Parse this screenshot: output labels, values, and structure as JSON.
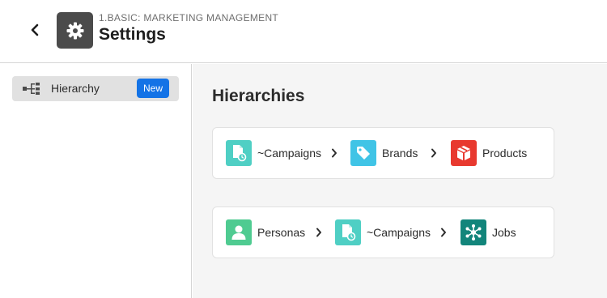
{
  "header": {
    "breadcrumb": "1.BASIC: MARKETING MANAGEMENT",
    "title": "Settings",
    "app_icon": "gear-icon",
    "back_icon": "chevron-left-icon"
  },
  "sidebar": {
    "items": [
      {
        "label": "Hierarchy",
        "icon": "hierarchy-icon",
        "badge": "New",
        "selected": true
      }
    ]
  },
  "main": {
    "title": "Hierarchies",
    "hierarchies": [
      {
        "nodes": [
          {
            "label": "~Campaigns",
            "icon": "campaign-document-icon",
            "color": "#4fcfc4"
          },
          {
            "label": "Brands",
            "icon": "tag-icon",
            "color": "#40c4e6"
          },
          {
            "label": "Products",
            "icon": "package-icon",
            "color": "#e8392f"
          }
        ]
      },
      {
        "nodes": [
          {
            "label": "Personas",
            "icon": "person-icon",
            "color": "#4fcb91"
          },
          {
            "label": "~Campaigns",
            "icon": "campaign-document-icon",
            "color": "#4fcfc4"
          },
          {
            "label": "Jobs",
            "icon": "network-icon",
            "color": "#12857b"
          }
        ]
      }
    ]
  },
  "colors": {
    "accent": "#1473e6",
    "background": "#f5f5f5",
    "sidebar_selected": "#e1e1e1"
  }
}
